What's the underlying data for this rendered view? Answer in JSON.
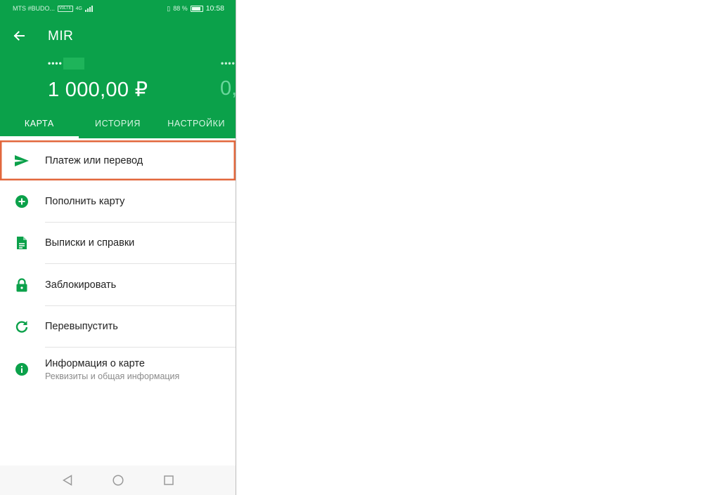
{
  "status_bar": {
    "carrier": "MTS #BUDO...",
    "network": "4G",
    "volte": "VoLTE",
    "battery_percent": "88 %",
    "time": "10:58"
  },
  "header": {
    "title": "MIR",
    "card_mask": "••••",
    "next_card_mask": "••••",
    "balance": "1 000,00 ₽",
    "next_balance": "0,"
  },
  "tabs": [
    {
      "label": "КАРТА",
      "active": true
    },
    {
      "label": "ИСТОРИЯ",
      "active": false
    },
    {
      "label": "НАСТРОЙКИ",
      "active": false
    }
  ],
  "menu": [
    {
      "label": "Платеж или перевод",
      "icon": "send-icon"
    },
    {
      "label": "Пополнить карту",
      "icon": "plus-circle-icon"
    },
    {
      "label": "Выписки и справки",
      "icon": "document-icon"
    },
    {
      "label": "Заблокировать",
      "icon": "lock-icon"
    },
    {
      "label": "Перевыпустить",
      "icon": "refresh-icon"
    },
    {
      "label": "Информация о карте",
      "sublabel": "Реквизиты и общая информация",
      "icon": "info-icon"
    }
  ],
  "colors": {
    "brand_green": "#0ba14a",
    "highlight": "#e2673c"
  },
  "nav": {
    "back": "back-triangle",
    "home": "home-circle",
    "recents": "recents-square"
  }
}
